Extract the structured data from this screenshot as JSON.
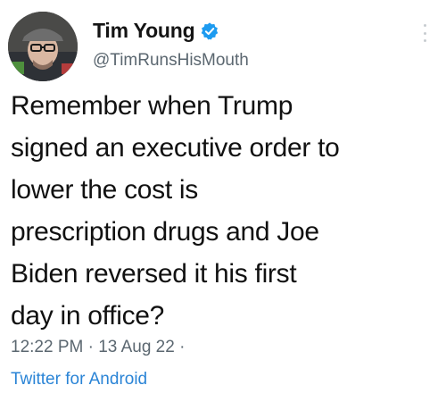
{
  "tweet": {
    "author": {
      "display_name": "Tim Young",
      "handle": "@TimRunsHisMouth",
      "verified": true,
      "avatar_icon": "profile-photo"
    },
    "text_lines": [
      "Remember when Trump",
      "signed an executive order to",
      "lower the cost is",
      "prescription drugs and Joe",
      "Biden reversed it his first",
      "day in office?"
    ],
    "time": "12:22 PM",
    "date": "13 Aug 22",
    "separator": "·",
    "source": "Twitter for Android"
  },
  "colors": {
    "verified_badge": "#1d9bf0",
    "handle_gray": "#5b6770",
    "link_blue": "#2a84d6",
    "text": "#111111"
  }
}
